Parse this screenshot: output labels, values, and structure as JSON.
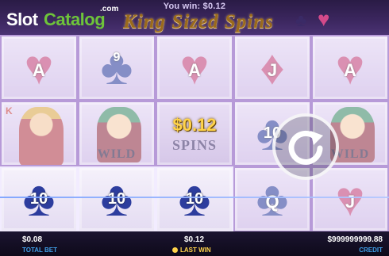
{
  "header": {
    "you_win": "You win: $0.12",
    "title": "King Sized Spins"
  },
  "logo": {
    "slot": "Slot",
    "catalog": "Catalog",
    "com": ".com"
  },
  "reels": {
    "row1": [
      {
        "rank": "A",
        "suit": "heart"
      },
      {
        "rank": "9",
        "suit": "club"
      },
      {
        "rank": "A",
        "suit": "heart"
      },
      {
        "rank": "J",
        "suit": "diamond"
      },
      {
        "rank": "A",
        "suit": "heart"
      }
    ],
    "row2": [
      {
        "king_letter": "K",
        "symbol": "king"
      },
      {
        "wild": "WILD",
        "symbol": "wild"
      },
      {
        "spins_text": "SPINS",
        "symbol": "spins"
      },
      {
        "rank": "10",
        "suit": "club"
      },
      {
        "wild": "WILD",
        "symbol": "wild"
      }
    ],
    "row3": [
      {
        "rank": "10",
        "suit": "club"
      },
      {
        "rank": "10",
        "suit": "club"
      },
      {
        "rank": "10",
        "suit": "club"
      },
      {
        "rank": "Q",
        "suit": "club"
      },
      {
        "rank": "J",
        "suit": "heart"
      }
    ]
  },
  "win_amount": "$0.12",
  "bottom": {
    "total_bet_value": "$0.08",
    "total_bet_label": "TOTAL BET",
    "last_win_value": "$0.12",
    "last_win_label": "LAST WIN",
    "credit_value": "$999999999.88",
    "credit_label": "CREDIT"
  },
  "colors": {
    "accent_gold": "#ffd34a",
    "label_blue": "#3f9de6",
    "heart": "#c0407a",
    "club": "#2d3d9e"
  }
}
